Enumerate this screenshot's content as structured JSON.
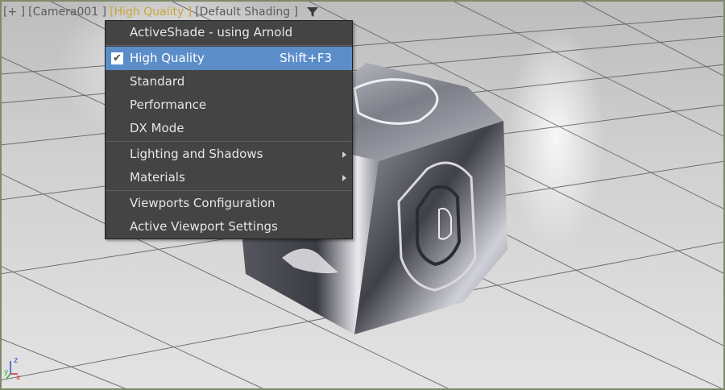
{
  "viewport_labels": {
    "plus": "[+ ]",
    "camera": "[Camera001 ]",
    "quality": "[High Quality ]",
    "shading": "[Default Shading ]"
  },
  "menu": {
    "header": "ActiveShade - using Arnold",
    "items": [
      {
        "label": "High Quality",
        "shortcut": "Shift+F3",
        "checked": true
      },
      {
        "label": "Standard"
      },
      {
        "label": "Performance"
      },
      {
        "label": "DX Mode"
      },
      {
        "label": "Lighting and Shadows",
        "submenu": true
      },
      {
        "label": "Materials",
        "submenu": true
      },
      {
        "label": "Viewports Configuration"
      },
      {
        "label": "Active Viewport Settings"
      }
    ]
  },
  "axis": {
    "z": "z",
    "x": "x",
    "y": "y"
  },
  "icons": [
    "filter-icon",
    "check-icon",
    "chevron-right-icon",
    "axis-gizmo-icon"
  ],
  "colors": {
    "active_label": "#c9a53a",
    "menu_bg": "#444444",
    "highlight": "#5b8dc9",
    "viewport_border": "#7f8a6a"
  }
}
